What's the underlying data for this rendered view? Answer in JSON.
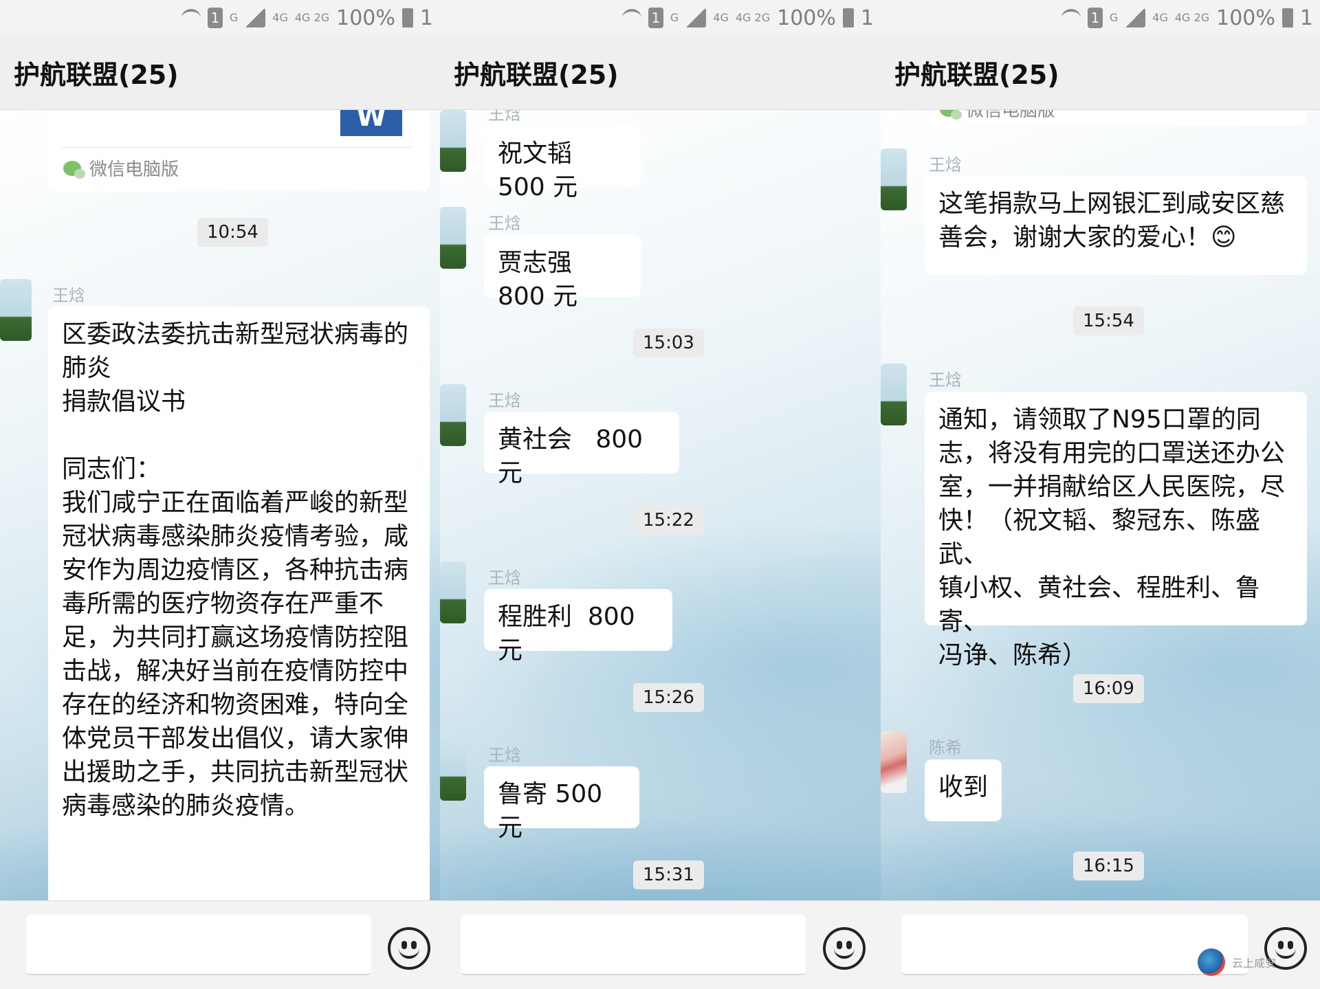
{
  "status_bar": {
    "sim_slot": "1",
    "network_g": "G",
    "network_4g": "4G",
    "network_4g2g": "4G 2G",
    "battery_text": "100%",
    "panel1_extra": "1",
    "panel2_extra": "1",
    "panel3_extra": "1"
  },
  "header": {
    "title": "护航联盟(25)"
  },
  "panel1": {
    "card_icon_letter": "W",
    "card_source": "微信电脑版",
    "time_1": "10:54",
    "sender_1": "王焓",
    "message_1": "区委政法委抗击新型冠状病毒的\n肺炎\n捐款倡议书\n\n同志们：\n我们咸宁正在面临着严峻的新型\n冠状病毒感染肺炎疫情考验，咸\n安作为周边疫情区，各种抗击病\n毒所需的医疗物资存在严重不\n足，为共同打赢这场疫情防控阻\n击战，解决好当前在疫情防控中\n存在的经济和物资困难，特向全\n体党员干部发出倡仪，请大家伸\n出援助之手，共同抗击新型冠状\n病毒感染的肺炎疫情。"
  },
  "panel2": {
    "messages": [
      {
        "sender": "王焓",
        "text": "祝文韬 500 元"
      },
      {
        "sender": "王焓",
        "text": "贾志强 800 元"
      },
      {
        "sender": "王焓",
        "text": "黄社会   800 元"
      },
      {
        "sender": "王焓",
        "text": "程胜利  800 元"
      },
      {
        "sender": "王焓",
        "text": "鲁寄 500 元"
      }
    ],
    "times": [
      "15:03",
      "15:22",
      "15:26",
      "15:31"
    ]
  },
  "panel3": {
    "card_source": "微信电脑版",
    "messages": [
      {
        "sender": "王焓",
        "text": "这笔捐款马上网银汇到咸安区慈\n善会，谢谢大家的爱心！😊"
      },
      {
        "sender": "王焓",
        "text": "通知，请领取了N95口罩的同\n志，将没有用完的口罩送还办公\n室，一并捐献给区人民医院，尽\n快！（祝文韬、黎冠东、陈盛武、\n镇小权、黄社会、程胜利、鲁寄、\n冯诤、陈希）"
      },
      {
        "sender": "陈希",
        "text": "收到"
      }
    ],
    "times": [
      "15:54",
      "16:09",
      "16:15"
    ]
  },
  "watermark": {
    "text": "云上咸安"
  },
  "icons": {
    "wifi": "wifi-icon",
    "sim": "sim-icon",
    "signal": "signal-icon",
    "battery": "battery-icon",
    "voice": "voice-toggle-icon",
    "emoji": "emoji-icon",
    "word_doc": "word-document-icon",
    "wechat": "wechat-icon"
  }
}
